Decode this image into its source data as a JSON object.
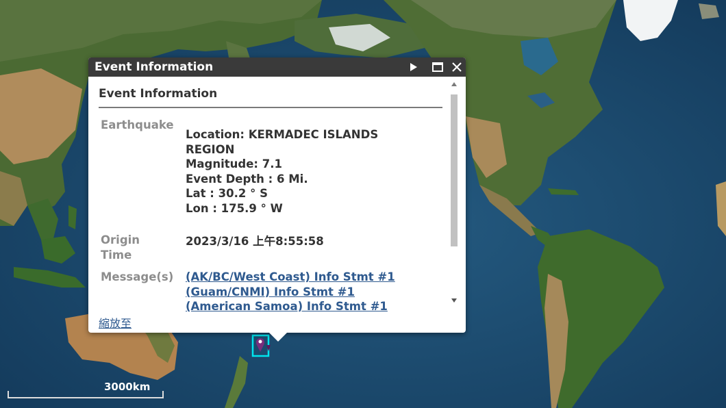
{
  "popup": {
    "title": "Event Information",
    "heading": "Event Information",
    "fields": [
      {
        "label": "Earthquake",
        "lines": [
          "Location: KERMADEC ISLANDS",
          "REGION",
          "Magnitude: 7.1",
          "Event Depth : 6 Mi.",
          "Lat : 30.2 ° S",
          "Lon : 175.9 ° W"
        ]
      },
      {
        "label_lines": [
          "Origin",
          "Time"
        ],
        "value": "2023/3/16 上午8:55:58"
      },
      {
        "label": "Message(s)",
        "links": [
          "(AK/BC/West Coast) Info Stmt #1",
          "(Guam/CNMI) Info Stmt #1",
          "(American Samoa) Info Stmt #1"
        ]
      }
    ],
    "zoom_link": "縮放至"
  },
  "scale": {
    "label": "3000km"
  },
  "colors": {
    "ocean_deep": "#163f63",
    "ocean": "#2a6a8e",
    "shelf": "#4d8ea8",
    "land_green": "#4f6b34",
    "land_arid": "#b38e5e",
    "ice": "#f2f4f5",
    "titlebar": "#3a3a3a",
    "link": "#2f5a8f",
    "marker": "#7a2e7e",
    "highlight": "#00e5ee"
  },
  "icons": [
    "play-icon",
    "maximize-icon",
    "close-icon",
    "scroll-up-arrow",
    "scroll-down-arrow",
    "earthquake-marker-icon"
  ]
}
